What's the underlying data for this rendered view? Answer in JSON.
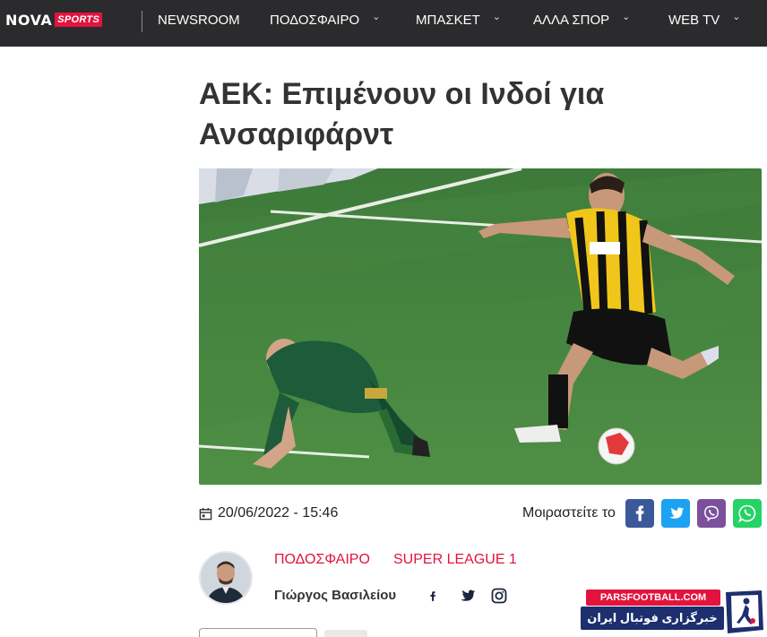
{
  "header": {
    "logo_nova": "NOVA",
    "logo_sports": "SPORTS",
    "nav": [
      {
        "label": "NEWSROOM"
      },
      {
        "label": "ΠΟΔΟΣΦΑΙΡΟ"
      },
      {
        "label": "ΜΠΑΣΚΕΤ"
      },
      {
        "label": "ΑΛΛΑ ΣΠΟΡ"
      },
      {
        "label": "WEB TV"
      }
    ]
  },
  "article": {
    "title": "ΑΕΚ: Επιμένουν οι Ινδοί για Ανσαριφάρντ",
    "date": "20/06/2022 - 15:46",
    "share_label": "Μοιραστείτε το",
    "tags": [
      "ΠΟΔΟΣΦΑΙΡΟ",
      "SUPER LEAGUE 1"
    ],
    "author": "Γιώργος Βασιλείου"
  },
  "watermark": {
    "top": "PARSFOOTBALL.COM",
    "bottom": "خبرگزاری فوتبال ایران"
  },
  "colors": {
    "nav_bg": "#2b2b2d",
    "accent": "#e2143d",
    "facebook": "#3b5998",
    "twitter": "#1da1f2",
    "viber": "#7b519d",
    "whatsapp": "#25d366"
  },
  "icons": [
    "calendar-icon",
    "facebook-icon",
    "twitter-icon",
    "viber-icon",
    "whatsapp-icon",
    "instagram-icon",
    "chevron-down-icon"
  ]
}
